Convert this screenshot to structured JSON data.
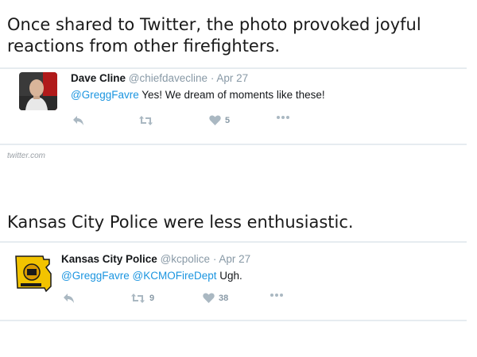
{
  "caption1": "Once shared to Twitter, the photo provoked joyful reactions from other firefighters.",
  "source": "twitter.com",
  "caption2": "Kansas City Police were less enthusiastic.",
  "tweet1": {
    "name": "Dave Cline",
    "handle": "@chiefdavecline",
    "separator": "·",
    "time": "Apr 27",
    "mention": "@GreggFavre",
    "text": " Yes! We dream of moments like these!",
    "retweets": "",
    "likes": "5",
    "avatar_icon": "person-photo",
    "like_color": "#aab8c2"
  },
  "tweet2": {
    "name": "Kansas City Police",
    "handle": "@kcpolice",
    "separator": "·",
    "time": "Apr 27",
    "mention1": "@GreggFavre",
    "mention2": "@KCMOFireDept",
    "text": " Ugh.",
    "retweets": "9",
    "likes": "38",
    "avatar_icon": "missouri-police-badge",
    "like_color": "#aab8c2"
  },
  "colors": {
    "link": "#1b95e0",
    "muted": "#8899a6",
    "divider": "#e6ecf0"
  }
}
